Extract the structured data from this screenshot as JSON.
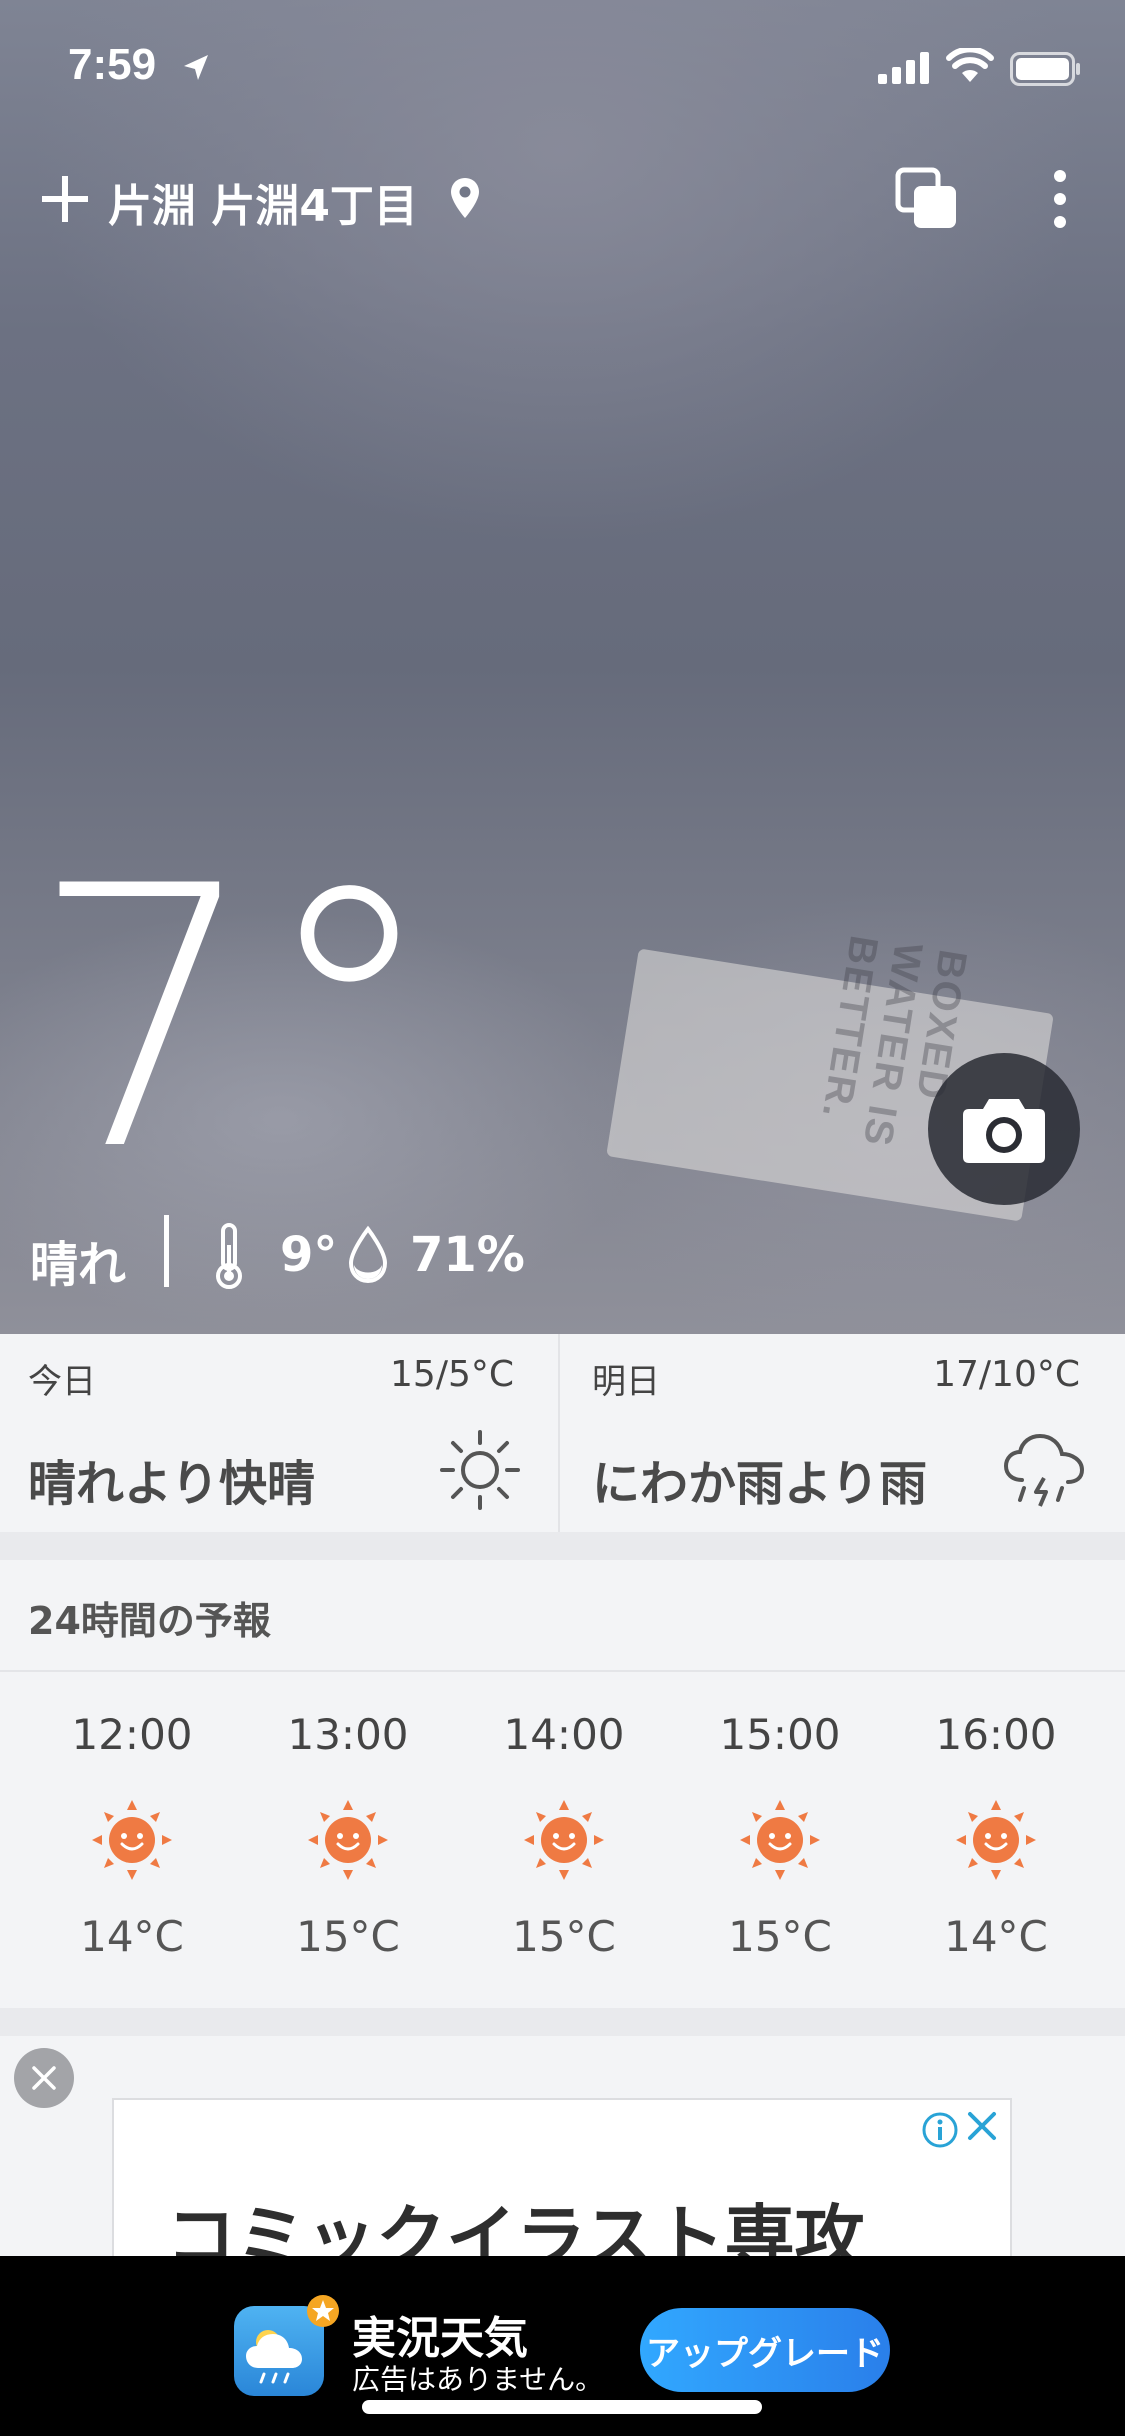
{
  "status_bar": {
    "time": "7:59"
  },
  "header": {
    "location": "片淵 片淵4丁目"
  },
  "current": {
    "temperature": "7°",
    "condition": "晴れ",
    "high": "9°",
    "humidity": "71%"
  },
  "background_text": "BOXED WATER IS BETTER.",
  "days": [
    {
      "label": "今日",
      "temp": "15/5°C",
      "desc": "晴れより快晴",
      "icon": "sun-outline-icon"
    },
    {
      "label": "明日",
      "temp": "17/10°C",
      "desc": "にわか雨より雨",
      "icon": "thunder-rain-cloud-icon"
    }
  ],
  "hourly": {
    "title": "24時間の予報",
    "items": [
      {
        "time": "12:00",
        "temp": "14°C",
        "icon": "sunny-face-icon"
      },
      {
        "time": "13:00",
        "temp": "15°C",
        "icon": "sunny-face-icon"
      },
      {
        "time": "14:00",
        "temp": "15°C",
        "icon": "sunny-face-icon"
      },
      {
        "time": "15:00",
        "temp": "15°C",
        "icon": "sunny-face-icon"
      },
      {
        "time": "16:00",
        "temp": "14°C",
        "icon": "sunny-face-icon"
      }
    ]
  },
  "ad": {
    "title": "コミックイラスト専攻"
  },
  "banner": {
    "app_name": "実況天気",
    "subtitle": "広告はありません。",
    "button": "アップグレード"
  },
  "colors": {
    "sun": "#ef7a43",
    "upgrade": "#2f96f5",
    "banner_bg": "#000000"
  }
}
